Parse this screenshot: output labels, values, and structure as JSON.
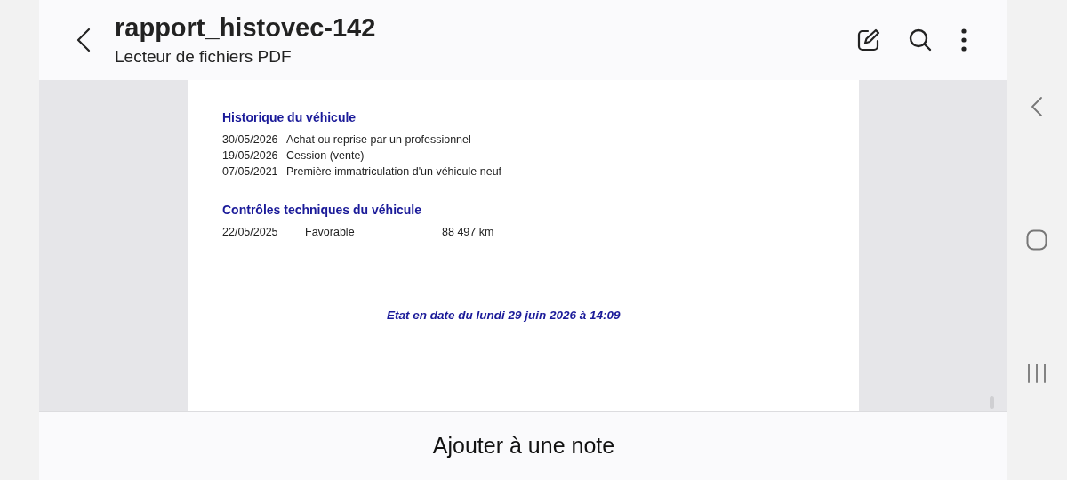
{
  "app_bar": {
    "title": "rapport_histovec-142",
    "subtitle": "Lecteur de fichiers PDF"
  },
  "document": {
    "history": {
      "heading": "Historique du véhicule",
      "rows": [
        {
          "date": "30/05/2026",
          "event": "Achat ou reprise par un professionnel"
        },
        {
          "date": "19/05/2026",
          "event": "Cession (vente)"
        },
        {
          "date": "07/05/2021",
          "event": "Première immatriculation d'un véhicule neuf"
        }
      ]
    },
    "inspections": {
      "heading": "Contrôles techniques du véhicule",
      "rows": [
        {
          "date": "22/05/2025",
          "result": "Favorable",
          "mileage": "88 497 km"
        }
      ]
    },
    "footer": "Etat en date du lundi 29 juin 2026 à 14:09"
  },
  "bottom_action": "Ajouter à une note"
}
